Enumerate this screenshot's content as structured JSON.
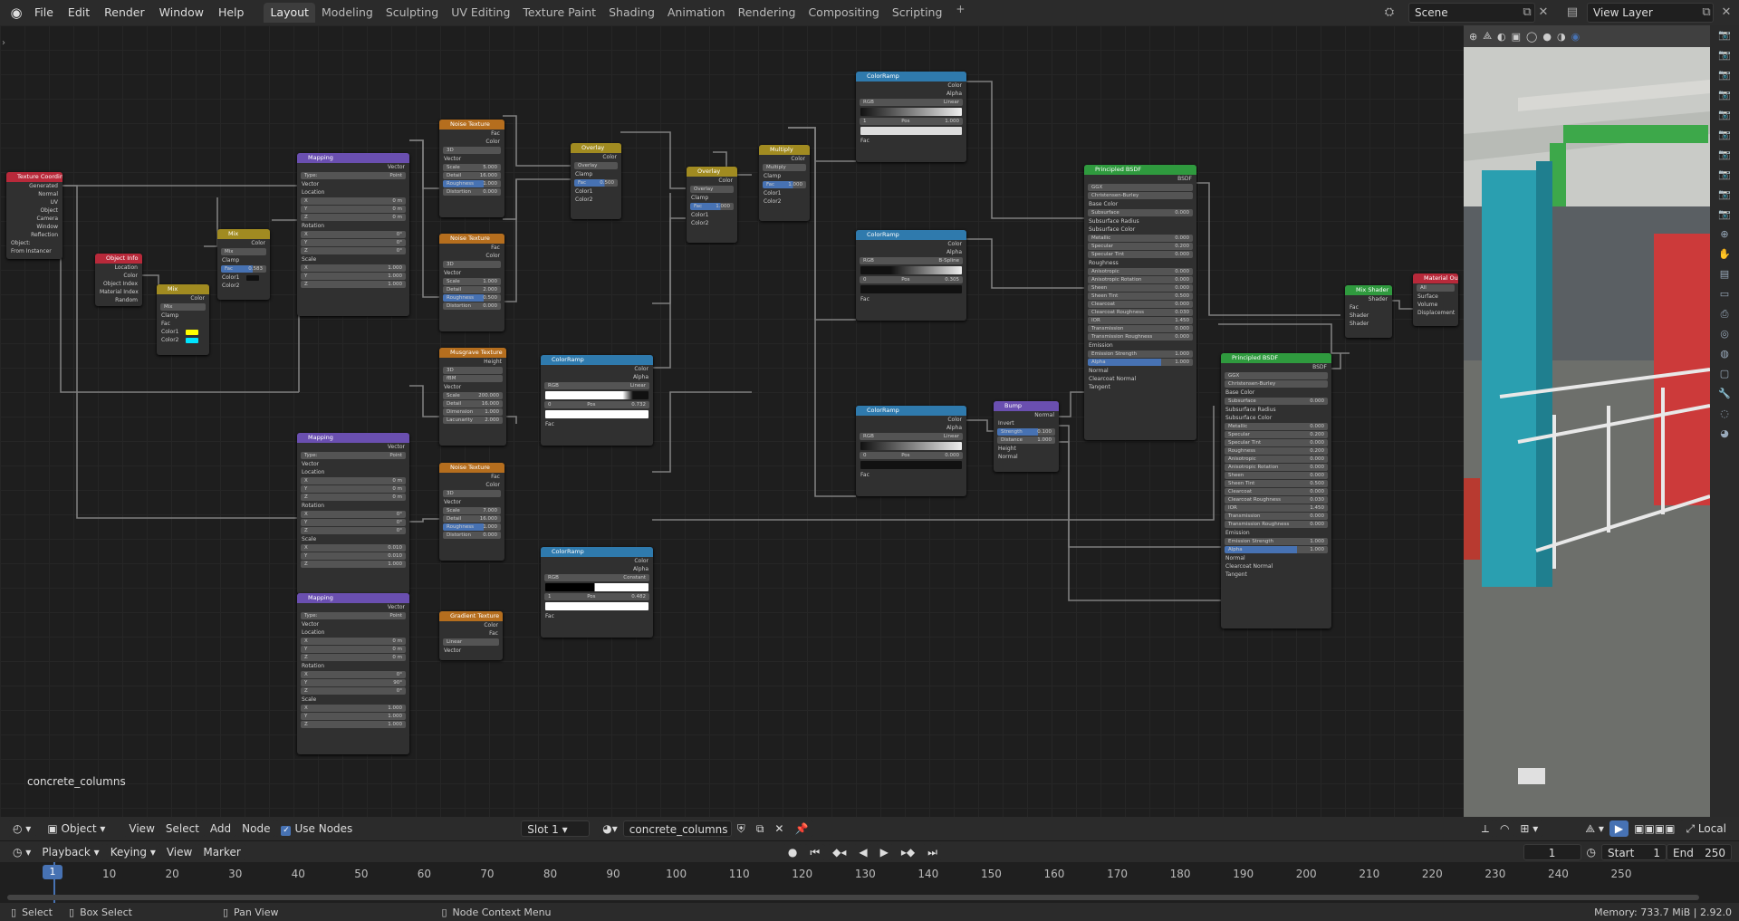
{
  "topbar": {
    "menus": [
      "File",
      "Edit",
      "Render",
      "Window",
      "Help"
    ],
    "workspaces": [
      "Layout",
      "Modeling",
      "Sculpting",
      "UV Editing",
      "Texture Paint",
      "Shading",
      "Animation",
      "Rendering",
      "Compositing",
      "Scripting"
    ],
    "active_workspace": "Layout",
    "scene": "Scene",
    "view_layer": "View Layer"
  },
  "node_editor": {
    "material_label": "concrete_columns",
    "nodes": {
      "texcoord": {
        "title": "Texture Coordinate",
        "outputs": [
          "Generated",
          "Normal",
          "UV",
          "Object",
          "Camera",
          "Window",
          "Reflection"
        ],
        "object": "Object:",
        "from_instancer": "From Instancer"
      },
      "objinfo": {
        "title": "Object Info",
        "outputs": [
          "Location",
          "Color",
          "Object Index",
          "Material Index",
          "Random"
        ]
      },
      "mix1": {
        "title": "Mix",
        "out": "Color",
        "mode": "Mix",
        "clamp": "Clamp",
        "fac": "Fac",
        "color1": "Color1",
        "color2": "Color2"
      },
      "mix2": {
        "title": "Mix",
        "out": "Color",
        "mode": "Mix",
        "clamp": "Clamp",
        "fac": "Fac",
        "fac_val": "0.583",
        "color1": "Color1",
        "color2": "Color2"
      },
      "mapping1": {
        "title": "Mapping",
        "out": "Vector",
        "type": "Type:",
        "type_val": "Point",
        "vector": "Vector",
        "location": "Location",
        "rotation": "Rotation",
        "scale": "Scale",
        "x": "X",
        "y": "Y",
        "z": "Z",
        "loc": [
          "0 m",
          "0 m",
          "0 m"
        ],
        "rot": [
          "0°",
          "0°",
          "0°"
        ],
        "scl": [
          "1.000",
          "1.000",
          "1.000"
        ]
      },
      "mapping2": {
        "title": "Mapping",
        "out": "Vector",
        "type": "Type:",
        "type_val": "Point",
        "vector": "Vector",
        "location": "Location",
        "rotation": "Rotation",
        "scale": "Scale",
        "x": "X",
        "y": "Y",
        "z": "Z",
        "loc": [
          "0 m",
          "0 m",
          "0 m"
        ],
        "rot": [
          "0°",
          "0°",
          "0°"
        ],
        "scl": [
          "0.010",
          "0.010",
          "1.000"
        ]
      },
      "mapping3": {
        "title": "Mapping",
        "out": "Vector",
        "type": "Type:",
        "type_val": "Point",
        "vector": "Vector",
        "location": "Location",
        "rotation": "Rotation",
        "scale": "Scale",
        "x": "X",
        "y": "Y",
        "z": "Z",
        "loc": [
          "0 m",
          "0 m",
          "0 m"
        ],
        "rot": [
          "0°",
          "90°",
          "0°"
        ],
        "scl": [
          "1.000",
          "1.000",
          "1.000"
        ]
      },
      "noise1": {
        "title": "Noise Texture",
        "outs": [
          "Fac",
          "Color"
        ],
        "dim": "3D",
        "vector": "Vector",
        "scale": [
          "Scale",
          "5.000"
        ],
        "detail": [
          "Detail",
          "16.000"
        ],
        "rough": [
          "Roughness",
          "1.000"
        ],
        "dist": [
          "Distortion",
          "0.000"
        ]
      },
      "noise2": {
        "title": "Noise Texture",
        "outs": [
          "Fac",
          "Color"
        ],
        "dim": "3D",
        "vector": "Vector",
        "scale": [
          "Scale",
          "1.000"
        ],
        "detail": [
          "Detail",
          "2.000"
        ],
        "rough": [
          "Roughness",
          "0.500"
        ],
        "dist": [
          "Distortion",
          "0.000"
        ]
      },
      "noise3": {
        "title": "Noise Texture",
        "outs": [
          "Fac",
          "Color"
        ],
        "dim": "3D",
        "vector": "Vector",
        "scale": [
          "Scale",
          "7.000"
        ],
        "detail": [
          "Detail",
          "16.000"
        ],
        "rough": [
          "Roughness",
          "1.000"
        ],
        "dist": [
          "Distortion",
          "0.000"
        ]
      },
      "musgrave": {
        "title": "Musgrave Texture",
        "out": "Height",
        "dim": "3D",
        "type": "fBM",
        "vector": "Vector",
        "scale": [
          "Scale",
          "200.000"
        ],
        "detail": [
          "Detail",
          "16.000"
        ],
        "dimension": [
          "Dimension",
          "1.000"
        ],
        "lac": [
          "Lacunarity",
          "2.000"
        ]
      },
      "gradient": {
        "title": "Gradient Texture",
        "outs": [
          "Color",
          "Fac"
        ],
        "type": "Linear",
        "vector": "Vector"
      },
      "overlay1": {
        "title": "Overlay",
        "out": "Color",
        "mode": "Overlay",
        "clamp": "Clamp",
        "fac": "Fac",
        "fac_val": "0.500",
        "color1": "Color1",
        "color2": "Color2"
      },
      "overlay2": {
        "title": "Overlay",
        "out": "Color",
        "mode": "Overlay",
        "clamp": "Clamp",
        "fac": "Fac",
        "fac_val": "1.000",
        "color1": "Color1",
        "color2": "Color2"
      },
      "multiply": {
        "title": "Multiply",
        "out": "Color",
        "mode": "Multiply",
        "clamp": "Clamp",
        "fac": "Fac",
        "fac_val": "1.000",
        "color1": "Color1",
        "color2": "Color2"
      },
      "ramp1": {
        "title": "ColorRamp",
        "outs": [
          "Color",
          "Alpha"
        ],
        "mode": "RGB",
        "interp": "Linear",
        "idx": "1",
        "pos": "Pos",
        "pos_val": "1.000",
        "fac": "Fac"
      },
      "ramp2": {
        "title": "ColorRamp",
        "outs": [
          "Color",
          "Alpha"
        ],
        "mode": "RGB",
        "interp": "B-Spline",
        "idx": "0",
        "pos": "Pos",
        "pos_val": "0.305",
        "fac": "Fac"
      },
      "ramp3": {
        "title": "ColorRamp",
        "outs": [
          "Color",
          "Alpha"
        ],
        "mode": "RGB",
        "interp": "Linear",
        "idx": "0",
        "pos": "Pos",
        "pos_val": "0.732",
        "fac": "Fac"
      },
      "ramp4": {
        "title": "ColorRamp",
        "outs": [
          "Color",
          "Alpha"
        ],
        "mode": "RGB",
        "interp": "Linear",
        "idx": "0",
        "pos": "Pos",
        "pos_val": "0.000",
        "fac": "Fac"
      },
      "ramp5": {
        "title": "ColorRamp",
        "outs": [
          "Color",
          "Alpha"
        ],
        "mode": "RGB",
        "interp": "Constant",
        "idx": "1",
        "pos": "Pos",
        "pos_val": "0.482",
        "fac": "Fac"
      },
      "bump": {
        "title": "Bump",
        "out": "Normal",
        "invert": "Invert",
        "strength": [
          "Strength",
          "0.100"
        ],
        "distance": [
          "Distance",
          "1.000"
        ],
        "height": "Height",
        "normal": "Normal"
      },
      "bsdf1": {
        "title": "Principled BSDF",
        "out": "BSDF",
        "dist": "GGX",
        "sss": "Christensen-Burley",
        "rows": [
          [
            "Base Color",
            ""
          ],
          [
            "Subsurface",
            "0.000"
          ],
          [
            "Subsurface Radius",
            ""
          ],
          [
            "Subsurface Color",
            ""
          ],
          [
            "Metallic",
            "0.000"
          ],
          [
            "Specular",
            "0.200"
          ],
          [
            "Specular Tint",
            "0.000"
          ],
          [
            "Roughness",
            ""
          ],
          [
            "Anisotropic",
            "0.000"
          ],
          [
            "Anisotropic Rotation",
            "0.000"
          ],
          [
            "Sheen",
            "0.000"
          ],
          [
            "Sheen Tint",
            "0.500"
          ],
          [
            "Clearcoat",
            "0.000"
          ],
          [
            "Clearcoat Roughness",
            "0.030"
          ],
          [
            "IOR",
            "1.450"
          ],
          [
            "Transmission",
            "0.000"
          ],
          [
            "Transmission Roughness",
            "0.000"
          ],
          [
            "Emission",
            ""
          ],
          [
            "Emission Strength",
            "1.000"
          ],
          [
            "Alpha",
            "1.000"
          ],
          [
            "Normal",
            ""
          ],
          [
            "Clearcoat Normal",
            ""
          ],
          [
            "Tangent",
            ""
          ]
        ]
      },
      "bsdf2": {
        "title": "Principled BSDF",
        "out": "BSDF",
        "dist": "GGX",
        "sss": "Christensen-Burley",
        "rows": [
          [
            "Base Color",
            ""
          ],
          [
            "Subsurface",
            "0.000"
          ],
          [
            "Subsurface Radius",
            ""
          ],
          [
            "Subsurface Color",
            ""
          ],
          [
            "Metallic",
            "0.000"
          ],
          [
            "Specular",
            "0.200"
          ],
          [
            "Specular Tint",
            "0.000"
          ],
          [
            "Roughness",
            "0.200"
          ],
          [
            "Anisotropic",
            "0.000"
          ],
          [
            "Anisotropic Rotation",
            "0.000"
          ],
          [
            "Sheen",
            "0.000"
          ],
          [
            "Sheen Tint",
            "0.500"
          ],
          [
            "Clearcoat",
            "0.000"
          ],
          [
            "Clearcoat Roughness",
            "0.030"
          ],
          [
            "IOR",
            "1.450"
          ],
          [
            "Transmission",
            "0.000"
          ],
          [
            "Transmission Roughness",
            "0.000"
          ],
          [
            "Emission",
            ""
          ],
          [
            "Emission Strength",
            "1.000"
          ],
          [
            "Alpha",
            "1.000"
          ],
          [
            "Normal",
            ""
          ],
          [
            "Clearcoat Normal",
            ""
          ],
          [
            "Tangent",
            ""
          ]
        ]
      },
      "mixshader": {
        "title": "Mix Shader",
        "out": "Shader",
        "fac": "Fac",
        "s1": "Shader",
        "s2": "Shader"
      },
      "matout": {
        "title": "Material Output",
        "target": "All",
        "surface": "Surface",
        "volume": "Volume",
        "disp": "Displacement"
      }
    }
  },
  "ne_header": {
    "object_mode": "Object",
    "menus": [
      "View",
      "Select",
      "Add",
      "Node"
    ],
    "use_nodes": "Use Nodes",
    "slot": "Slot 1",
    "material": "concrete_columns",
    "local": "Local"
  },
  "timeline": {
    "menus": [
      "Playback",
      "Keying",
      "View",
      "Marker"
    ],
    "current_frame": "1",
    "start_label": "Start",
    "start": "1",
    "end_label": "End",
    "end": "250",
    "ticks": [
      "1",
      "10",
      "20",
      "30",
      "40",
      "50",
      "60",
      "70",
      "80",
      "90",
      "100",
      "110",
      "120",
      "130",
      "140",
      "150",
      "160",
      "170",
      "180",
      "190",
      "200",
      "210",
      "220",
      "230",
      "240",
      "250"
    ]
  },
  "statusbar": {
    "select": "Select",
    "box_select": "Box Select",
    "pan": "Pan View",
    "context": "Node Context Menu",
    "memory": "Memory: 733.7 MiB | 2.92.0"
  },
  "colors": {
    "accent": "#4772b3",
    "yellow": "#ffff00",
    "cyan": "#00e5ff"
  }
}
